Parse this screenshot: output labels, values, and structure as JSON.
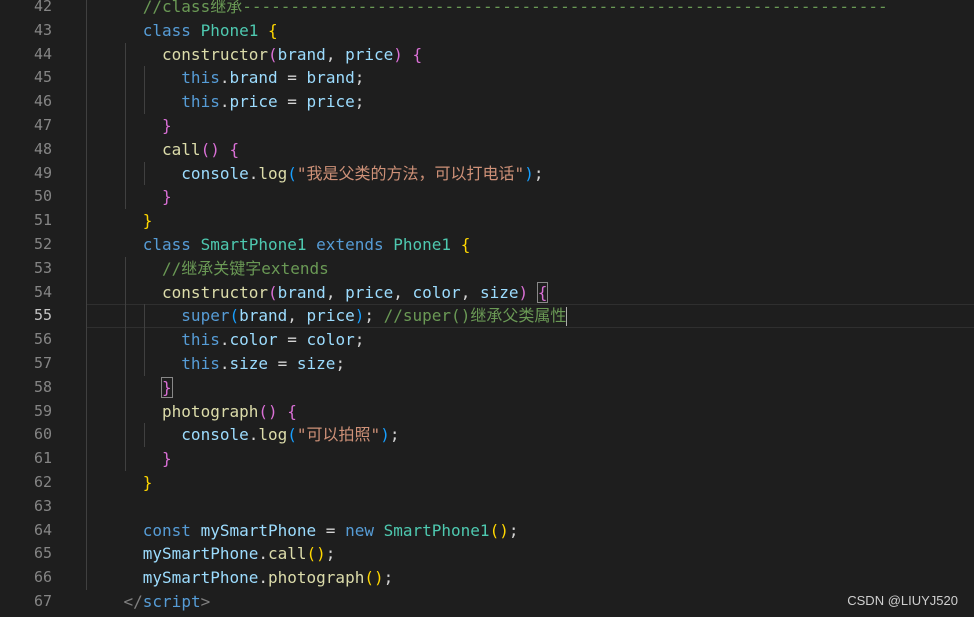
{
  "colors": {
    "background": "#1e1e1e",
    "keyword": "#569cd6",
    "class_name": "#4ec9b0",
    "function": "#dcdcaa",
    "variable": "#9cdcfe",
    "string": "#ce9178",
    "comment": "#6a9955",
    "text": "#d4d4d4",
    "bracket_gold": "#ffd700",
    "bracket_purple": "#da70d6",
    "bracket_blue": "#179fff"
  },
  "editor": {
    "current_line": 55,
    "lines": [
      {
        "n": "42",
        "indent": 3,
        "guides": [
          1
        ],
        "tokens": [
          {
            "t": "//class继承-------------------------------------------------------------------",
            "c": "comment"
          }
        ]
      },
      {
        "n": "43",
        "indent": 3,
        "guides": [
          1
        ],
        "tokens": [
          {
            "t": "class ",
            "c": "keyword"
          },
          {
            "t": "Phone1",
            "c": "class_name"
          },
          {
            "t": " ",
            "c": "text"
          },
          {
            "t": "{",
            "c": "bracket_gold"
          }
        ]
      },
      {
        "n": "44",
        "indent": 4,
        "guides": [
          1,
          3
        ],
        "tokens": [
          {
            "t": "constructor",
            "c": "function"
          },
          {
            "t": "(",
            "c": "bracket_purple"
          },
          {
            "t": "brand",
            "c": "variable"
          },
          {
            "t": ", ",
            "c": "text"
          },
          {
            "t": "price",
            "c": "variable"
          },
          {
            "t": ")",
            "c": "bracket_purple"
          },
          {
            "t": " ",
            "c": "text"
          },
          {
            "t": "{",
            "c": "bracket_purple"
          }
        ]
      },
      {
        "n": "45",
        "indent": 5,
        "guides": [
          1,
          3,
          4
        ],
        "tokens": [
          {
            "t": "this",
            "c": "keyword"
          },
          {
            "t": ".",
            "c": "text"
          },
          {
            "t": "brand",
            "c": "variable"
          },
          {
            "t": " = ",
            "c": "text"
          },
          {
            "t": "brand",
            "c": "variable"
          },
          {
            "t": ";",
            "c": "text"
          }
        ]
      },
      {
        "n": "46",
        "indent": 5,
        "guides": [
          1,
          3,
          4
        ],
        "tokens": [
          {
            "t": "this",
            "c": "keyword"
          },
          {
            "t": ".",
            "c": "text"
          },
          {
            "t": "price",
            "c": "variable"
          },
          {
            "t": " = ",
            "c": "text"
          },
          {
            "t": "price",
            "c": "variable"
          },
          {
            "t": ";",
            "c": "text"
          }
        ]
      },
      {
        "n": "47",
        "indent": 4,
        "guides": [
          1,
          3
        ],
        "tokens": [
          {
            "t": "}",
            "c": "bracket_purple"
          }
        ]
      },
      {
        "n": "48",
        "indent": 4,
        "guides": [
          1,
          3
        ],
        "tokens": [
          {
            "t": "call",
            "c": "function"
          },
          {
            "t": "()",
            "c": "bracket_purple"
          },
          {
            "t": " ",
            "c": "text"
          },
          {
            "t": "{",
            "c": "bracket_purple"
          }
        ]
      },
      {
        "n": "49",
        "indent": 5,
        "guides": [
          1,
          3,
          4
        ],
        "tokens": [
          {
            "t": "console",
            "c": "variable"
          },
          {
            "t": ".",
            "c": "text"
          },
          {
            "t": "log",
            "c": "function"
          },
          {
            "t": "(",
            "c": "bracket_blue"
          },
          {
            "t": "\"我是父类的方法，可以打电话\"",
            "c": "string"
          },
          {
            "t": ")",
            "c": "bracket_blue"
          },
          {
            "t": ";",
            "c": "text"
          }
        ]
      },
      {
        "n": "50",
        "indent": 4,
        "guides": [
          1,
          3
        ],
        "tokens": [
          {
            "t": "}",
            "c": "bracket_purple"
          }
        ]
      },
      {
        "n": "51",
        "indent": 3,
        "guides": [
          1
        ],
        "tokens": [
          {
            "t": "}",
            "c": "bracket_gold"
          }
        ]
      },
      {
        "n": "52",
        "indent": 3,
        "guides": [
          1
        ],
        "tokens": [
          {
            "t": "class ",
            "c": "keyword"
          },
          {
            "t": "SmartPhone1",
            "c": "class_name"
          },
          {
            "t": " ",
            "c": "text"
          },
          {
            "t": "extends",
            "c": "keyword"
          },
          {
            "t": " ",
            "c": "text"
          },
          {
            "t": "Phone1",
            "c": "class_name"
          },
          {
            "t": " ",
            "c": "text"
          },
          {
            "t": "{",
            "c": "bracket_gold"
          }
        ]
      },
      {
        "n": "53",
        "indent": 4,
        "guides": [
          1,
          3
        ],
        "tokens": [
          {
            "t": "//继承关键字extends",
            "c": "comment"
          }
        ]
      },
      {
        "n": "54",
        "indent": 4,
        "guides": [
          1,
          3
        ],
        "tokens": [
          {
            "t": "constructor",
            "c": "function"
          },
          {
            "t": "(",
            "c": "bracket_purple"
          },
          {
            "t": "brand",
            "c": "variable"
          },
          {
            "t": ", ",
            "c": "text"
          },
          {
            "t": "price",
            "c": "variable"
          },
          {
            "t": ", ",
            "c": "text"
          },
          {
            "t": "color",
            "c": "variable"
          },
          {
            "t": ", ",
            "c": "text"
          },
          {
            "t": "size",
            "c": "variable"
          },
          {
            "t": ")",
            "c": "bracket_purple"
          },
          {
            "t": " ",
            "c": "text"
          },
          {
            "t": "{",
            "c": "bracket_purple",
            "bm": true
          }
        ]
      },
      {
        "n": "55",
        "indent": 5,
        "guides": [
          1,
          3,
          4
        ],
        "tokens": [
          {
            "t": "super",
            "c": "keyword"
          },
          {
            "t": "(",
            "c": "bracket_blue"
          },
          {
            "t": "brand",
            "c": "variable"
          },
          {
            "t": ", ",
            "c": "text"
          },
          {
            "t": "price",
            "c": "variable"
          },
          {
            "t": ")",
            "c": "bracket_blue"
          },
          {
            "t": "; ",
            "c": "text"
          },
          {
            "t": "//super()继承父类属性",
            "c": "comment"
          }
        ],
        "cursor": true
      },
      {
        "n": "56",
        "indent": 5,
        "guides": [
          1,
          3,
          4
        ],
        "tokens": [
          {
            "t": "this",
            "c": "keyword"
          },
          {
            "t": ".",
            "c": "text"
          },
          {
            "t": "color",
            "c": "variable"
          },
          {
            "t": " = ",
            "c": "text"
          },
          {
            "t": "color",
            "c": "variable"
          },
          {
            "t": ";",
            "c": "text"
          }
        ]
      },
      {
        "n": "57",
        "indent": 5,
        "guides": [
          1,
          3,
          4
        ],
        "tokens": [
          {
            "t": "this",
            "c": "keyword"
          },
          {
            "t": ".",
            "c": "text"
          },
          {
            "t": "size",
            "c": "variable"
          },
          {
            "t": " = ",
            "c": "text"
          },
          {
            "t": "size",
            "c": "variable"
          },
          {
            "t": ";",
            "c": "text"
          }
        ]
      },
      {
        "n": "58",
        "indent": 4,
        "guides": [
          1,
          3
        ],
        "tokens": [
          {
            "t": "}",
            "c": "bracket_purple",
            "bm": true
          }
        ]
      },
      {
        "n": "59",
        "indent": 4,
        "guides": [
          1,
          3
        ],
        "tokens": [
          {
            "t": "photograph",
            "c": "function"
          },
          {
            "t": "()",
            "c": "bracket_purple"
          },
          {
            "t": " ",
            "c": "text"
          },
          {
            "t": "{",
            "c": "bracket_purple"
          }
        ]
      },
      {
        "n": "60",
        "indent": 5,
        "guides": [
          1,
          3,
          4
        ],
        "tokens": [
          {
            "t": "console",
            "c": "variable"
          },
          {
            "t": ".",
            "c": "text"
          },
          {
            "t": "log",
            "c": "function"
          },
          {
            "t": "(",
            "c": "bracket_blue"
          },
          {
            "t": "\"可以拍照\"",
            "c": "string"
          },
          {
            "t": ")",
            "c": "bracket_blue"
          },
          {
            "t": ";",
            "c": "text"
          }
        ]
      },
      {
        "n": "61",
        "indent": 4,
        "guides": [
          1,
          3
        ],
        "tokens": [
          {
            "t": "}",
            "c": "bracket_purple"
          }
        ]
      },
      {
        "n": "62",
        "indent": 3,
        "guides": [
          1
        ],
        "tokens": [
          {
            "t": "}",
            "c": "bracket_gold"
          }
        ]
      },
      {
        "n": "63",
        "indent": 0,
        "guides": [
          1
        ],
        "tokens": []
      },
      {
        "n": "64",
        "indent": 3,
        "guides": [
          1
        ],
        "tokens": [
          {
            "t": "const ",
            "c": "keyword"
          },
          {
            "t": "mySmartPhone",
            "c": "variable"
          },
          {
            "t": " = ",
            "c": "text"
          },
          {
            "t": "new ",
            "c": "keyword"
          },
          {
            "t": "SmartPhone1",
            "c": "class_name"
          },
          {
            "t": "()",
            "c": "bracket_gold"
          },
          {
            "t": ";",
            "c": "text"
          }
        ]
      },
      {
        "n": "65",
        "indent": 3,
        "guides": [
          1
        ],
        "tokens": [
          {
            "t": "mySmartPhone",
            "c": "variable"
          },
          {
            "t": ".",
            "c": "text"
          },
          {
            "t": "call",
            "c": "function"
          },
          {
            "t": "()",
            "c": "bracket_gold"
          },
          {
            "t": ";",
            "c": "text"
          }
        ]
      },
      {
        "n": "66",
        "indent": 3,
        "guides": [
          1
        ],
        "tokens": [
          {
            "t": "mySmartPhone",
            "c": "variable"
          },
          {
            "t": ".",
            "c": "text"
          },
          {
            "t": "photograph",
            "c": "function"
          },
          {
            "t": "()",
            "c": "bracket_gold"
          },
          {
            "t": ";",
            "c": "text"
          }
        ]
      },
      {
        "n": "67",
        "indent": 2,
        "guides": [],
        "tokens": [
          {
            "t": "</",
            "c": "comment_gray"
          },
          {
            "t": "script",
            "c": "keyword"
          },
          {
            "t": ">",
            "c": "comment_gray"
          }
        ]
      }
    ]
  },
  "watermark": "CSDN @LIUYJ520"
}
